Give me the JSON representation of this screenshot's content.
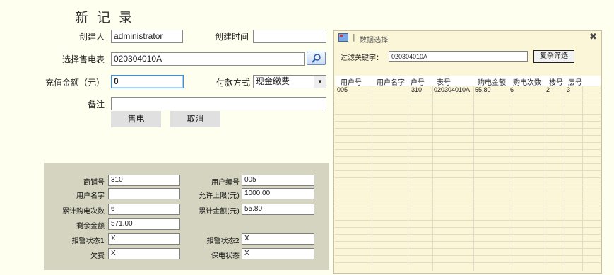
{
  "title": "新 记 录",
  "form": {
    "creator_label": "创建人",
    "creator_value": "administrator",
    "create_time_label": "创建时间",
    "create_time_value": "",
    "meter_label": "选择售电表",
    "meter_value": "020304010A",
    "amount_label": "充值金额（元）",
    "amount_value": "0",
    "payment_label": "付款方式",
    "payment_value": "现金缴费",
    "note_label": "备注",
    "note_value": "",
    "sell_button": "售电",
    "cancel_button": "取消"
  },
  "info": {
    "shop_no_label": "商铺号",
    "shop_no": "310",
    "user_no_label": "用户编号",
    "user_no": "005",
    "user_name_label": "用户名字",
    "user_name": "",
    "limit_label": "允许上限(元)",
    "limit": "1000.00",
    "buy_count_label": "累计购电次数",
    "buy_count": "6",
    "total_amount_label": "累计金额(元)",
    "total_amount": "55.80",
    "balance_label": "剩余金额",
    "balance": "571.00",
    "alarm1_label": "报警状态1",
    "alarm1": "X",
    "alarm2_label": "报警状态2",
    "alarm2": "X",
    "arrears_label": "欠费",
    "arrears": "X",
    "hold_label": "保电状态",
    "hold": "X"
  },
  "popup": {
    "title": "数据选择",
    "filter_label": "过滤关键字：",
    "filter_value": "020304010A",
    "complex_button": "复杂筛选",
    "columns": [
      "用户号",
      "用户名字",
      "户号",
      "表号",
      "购电金额",
      "购电次数",
      "楼号",
      "层号"
    ],
    "rows": [
      [
        "005",
        "",
        "310",
        "020304010A",
        "55.80",
        "6",
        "2",
        "3"
      ]
    ]
  }
}
